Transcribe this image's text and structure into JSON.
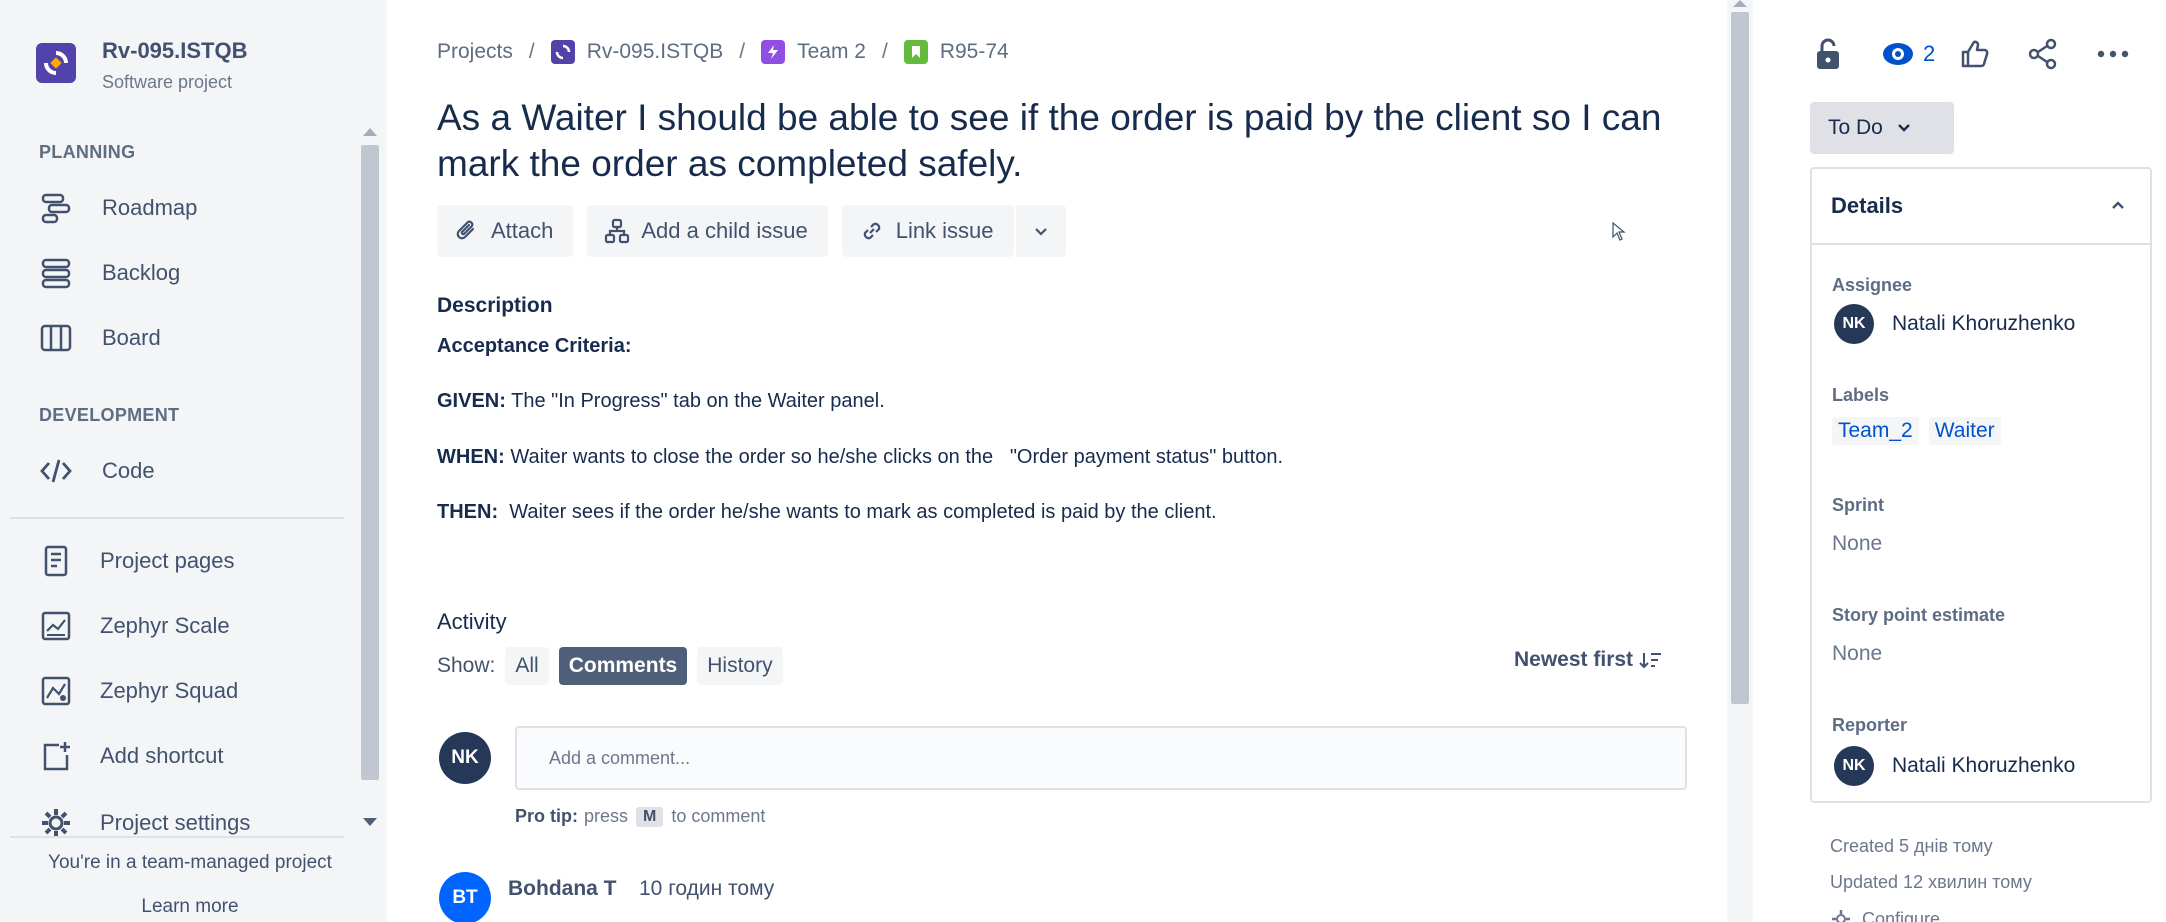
{
  "sidebar": {
    "project_name": "Rv-095.ISTQB",
    "project_type": "Software project",
    "planning_title": "PLANNING",
    "planning_items": [
      {
        "label": "Roadmap",
        "icon": "roadmap-icon"
      },
      {
        "label": "Backlog",
        "icon": "backlog-icon"
      },
      {
        "label": "Board",
        "icon": "board-icon"
      }
    ],
    "development_title": "DEVELOPMENT",
    "development_items": [
      {
        "label": "Code",
        "icon": "code-icon"
      }
    ],
    "other_items": [
      {
        "label": "Project pages",
        "icon": "page-icon"
      },
      {
        "label": "Zephyr Scale",
        "icon": "zephyr-scale-icon"
      },
      {
        "label": "Zephyr Squad",
        "icon": "zephyr-squad-icon"
      },
      {
        "label": "Add shortcut",
        "icon": "add-shortcut-icon"
      },
      {
        "label": "Project settings",
        "icon": "gear-icon"
      }
    ],
    "footer_text": "You're in a team-managed project",
    "learn_more": "Learn more"
  },
  "breadcrumbs": [
    "Projects",
    "Rv-095.ISTQB",
    "Team 2",
    "R95-74"
  ],
  "issue": {
    "title": "As a Waiter I should be able to see if the order is paid by the client so I can mark the order as completed safely."
  },
  "actions": {
    "attach": "Attach",
    "add_child": "Add a child issue",
    "link_issue": "Link issue"
  },
  "description": {
    "label": "Description",
    "acceptance": "Acceptance Criteria:",
    "given_key": "GIVEN:",
    "given_text": " The \"In Progress\" tab on the Waiter panel.",
    "when_key": "WHEN:",
    "when_text": " Waiter wants to close the order so he/she clicks on the   \"Order payment status\" button.",
    "then_key": "THEN:",
    "then_text": "  Waiter sees if the order he/she wants to mark as completed is paid by the client."
  },
  "activity": {
    "label": "Activity",
    "show_label": "Show:",
    "tabs": [
      "All",
      "Comments",
      "History"
    ],
    "active_tab": "Comments",
    "sort_label": "Newest first",
    "comment_avatar": "NK",
    "comment_placeholder": "Add a comment...",
    "pro_tip_bold": "Pro tip:",
    "pro_tip_press": "press",
    "pro_tip_key": "M",
    "pro_tip_rest": "to comment",
    "last_comment": {
      "initials": "BT",
      "author": "Bohdana T",
      "time": "10 годин тому"
    }
  },
  "right_panel": {
    "watch_count": "2",
    "status": "To Do",
    "details_title": "Details",
    "assignee_label": "Assignee",
    "assignee": {
      "initials": "NK",
      "name": "Natali Khoruzhenko"
    },
    "labels_label": "Labels",
    "labels": [
      "Team_2",
      "Waiter"
    ],
    "sprint_label": "Sprint",
    "sprint_value": "None",
    "story_points_label": "Story point estimate",
    "story_points_value": "None",
    "reporter_label": "Reporter",
    "reporter": {
      "initials": "NK",
      "name": "Natali Khoruzhenko"
    },
    "created": "Created 5 днів тому",
    "updated": "Updated 12 хвилин тому",
    "configure_partial": "Configure"
  },
  "colors": {
    "accent": "#0052cc",
    "project_avatar": "#5243aa",
    "sidebar_bg": "#f4f5f7",
    "text_primary": "#172b4d",
    "text_secondary": "#42526e"
  }
}
